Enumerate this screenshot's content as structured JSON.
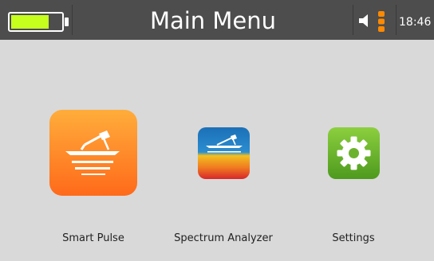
{
  "status_bar": {
    "title": "Main Menu",
    "time": "18:46",
    "battery_level": 0.75,
    "volume_level": 3,
    "colors": {
      "bar": "#4d4d4d",
      "battery": "#c6ff1e",
      "volume": "#ff8a00"
    }
  },
  "apps": [
    {
      "label": "Smart Pulse",
      "icon": "smart-pulse-icon",
      "selected": true
    },
    {
      "label": "Spectrum Analyzer",
      "icon": "spectrum-analyzer-icon",
      "selected": false
    },
    {
      "label": "Settings",
      "icon": "settings-gear-icon",
      "selected": false
    }
  ]
}
